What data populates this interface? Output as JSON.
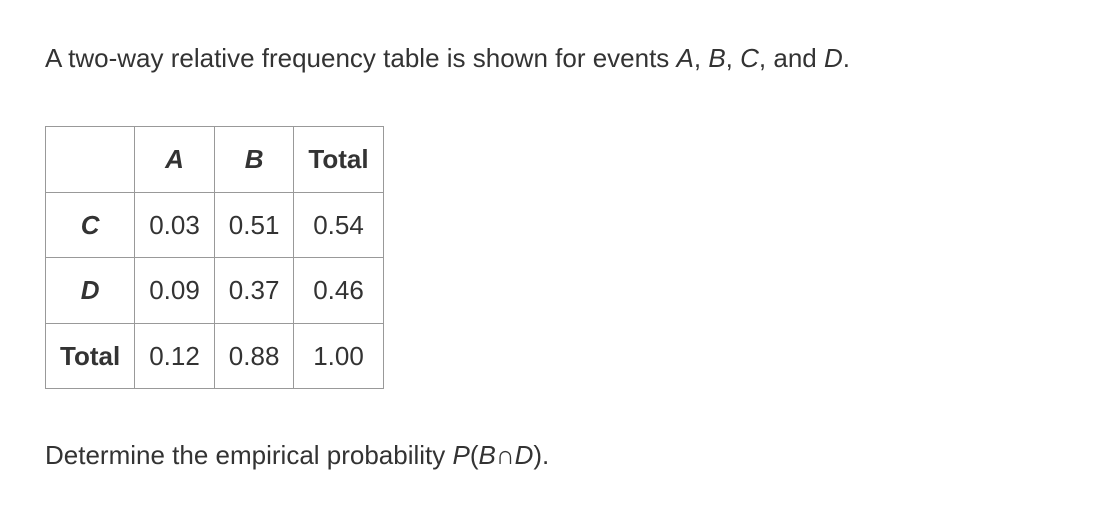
{
  "intro": {
    "prefix": "A two-way relative frequency table is shown for events ",
    "eventA": "A",
    "sep1": ", ",
    "eventB": "B",
    "sep2": ", ",
    "eventC": "C",
    "sep3": ", and ",
    "eventD": "D",
    "suffix": "."
  },
  "chart_data": {
    "type": "table",
    "title": "Two-way relative frequency table",
    "columns": [
      "A",
      "B",
      "Total"
    ],
    "rows": [
      "C",
      "D",
      "Total"
    ],
    "data": [
      [
        0.03,
        0.51,
        0.54
      ],
      [
        0.09,
        0.37,
        0.46
      ],
      [
        0.12,
        0.88,
        1.0
      ]
    ]
  },
  "table": {
    "colA": "A",
    "colB": "B",
    "colTotal": "Total",
    "rowC": "C",
    "rowD": "D",
    "rowTotal": "Total",
    "c_a": "0.03",
    "c_b": "0.51",
    "c_total": "0.54",
    "d_a": "0.09",
    "d_b": "0.37",
    "d_total": "0.46",
    "total_a": "0.12",
    "total_b": "0.88",
    "total_total": "1.00"
  },
  "question": {
    "prefix": "Determine the empirical probability ",
    "pOpen": "P",
    "paren_open": "(",
    "eventB": "B",
    "intersect": "∩",
    "eventD": "D",
    "paren_close": ")",
    "suffix": "."
  }
}
